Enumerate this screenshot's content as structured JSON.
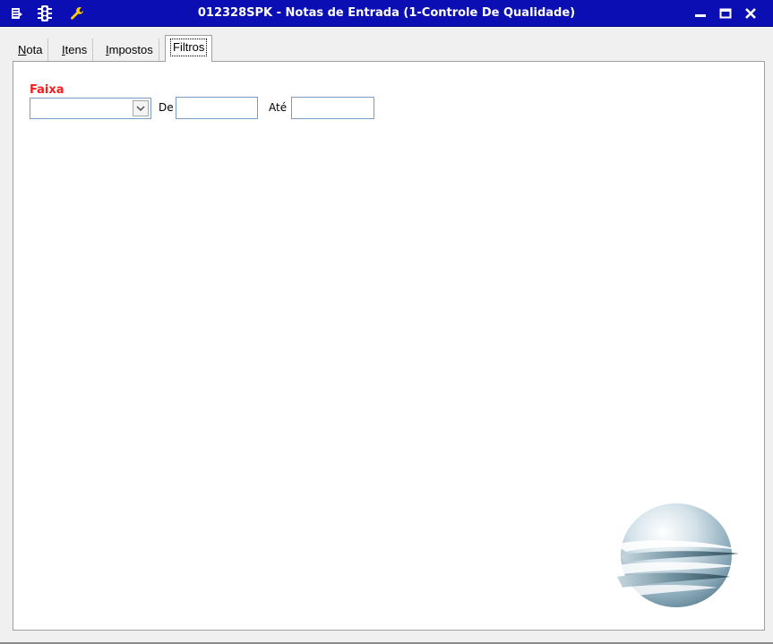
{
  "window": {
    "title": "012328SPK - Notas de Entrada (1-Controle De Qualidade)",
    "titlebar_color": "#0b0eb3",
    "icons": [
      "menu-icon",
      "traffic-light-icon",
      "wrench-icon"
    ],
    "controls": [
      "minimize-icon",
      "maximize-icon",
      "close-icon"
    ]
  },
  "tabs": [
    {
      "label": "Nota",
      "accel": "N",
      "rest": "ota"
    },
    {
      "label": "Itens",
      "accel": "I",
      "rest": "tens"
    },
    {
      "label": "Impostos",
      "accel": "I",
      "rest": "mpostos"
    },
    {
      "label": "Filtros",
      "active": true
    }
  ],
  "filters": {
    "faixa_label": "Faixa",
    "faixa_label_color": "#ff1a1a",
    "faixa_value": "",
    "de_label": "De",
    "de_value": "",
    "ate_label": "Até",
    "ate_value": ""
  }
}
